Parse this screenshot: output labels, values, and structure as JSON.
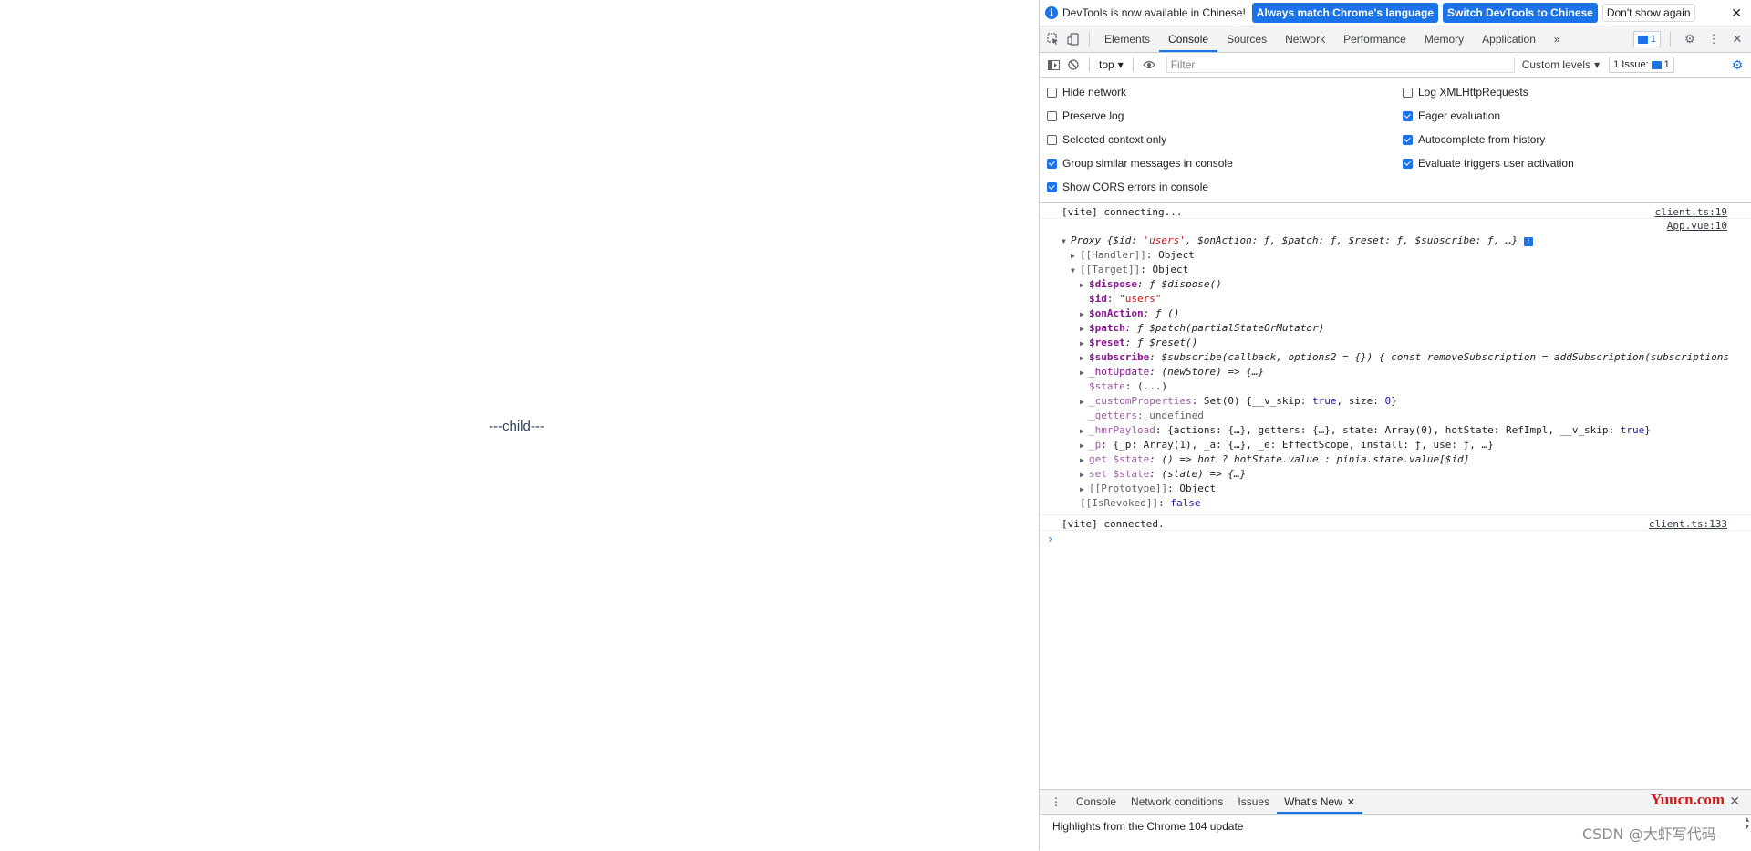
{
  "page": {
    "child_text": "---child---"
  },
  "infobar": {
    "message": "DevTools is now available in Chinese!",
    "btn_match": "Always match Chrome's language",
    "btn_switch": "Switch DevTools to Chinese",
    "btn_dont_show": "Don't show again",
    "info_icon": "info-icon",
    "close_glyph": "✕"
  },
  "tabs": {
    "items": [
      "Elements",
      "Console",
      "Sources",
      "Network",
      "Performance",
      "Memory",
      "Application"
    ],
    "active": "Console",
    "more_glyph": "»",
    "issues_count": "1"
  },
  "toolbar": {
    "context": "top",
    "filter_placeholder": "Filter",
    "levels": "Custom levels",
    "issue_btn": "1 Issue:",
    "issue_count": "1"
  },
  "settings": {
    "left": [
      {
        "label": "Hide network",
        "checked": false
      },
      {
        "label": "Preserve log",
        "checked": false
      },
      {
        "label": "Selected context only",
        "checked": false
      },
      {
        "label": "Group similar messages in console",
        "checked": true
      },
      {
        "label": "Show CORS errors in console",
        "checked": true
      }
    ],
    "right": [
      {
        "label": "Log XMLHttpRequests",
        "checked": false
      },
      {
        "label": "Eager evaluation",
        "checked": true
      },
      {
        "label": "Autocomplete from history",
        "checked": true
      },
      {
        "label": "Evaluate triggers user activation",
        "checked": true
      }
    ]
  },
  "console": {
    "log1": {
      "text": "[vite] connecting...",
      "source": "client.ts:19"
    },
    "proxy": {
      "source": "App.vue:10",
      "summary_prefix": "Proxy {$id: ",
      "summary_id": "'users'",
      "summary_rest": ", $onAction: ƒ, $patch: ƒ, $reset: ƒ, $subscribe: ƒ, …}",
      "handler": "[[Handler]]",
      "handler_val": ": Object",
      "target": "[[Target]]",
      "target_val": ": Object",
      "dispose_k": "$dispose",
      "dispose_v": ": ƒ $dispose()",
      "id_k": "$id",
      "id_v": "\"users\"",
      "onaction_k": "$onAction",
      "onaction_v": ": ƒ ()",
      "patch_k": "$patch",
      "patch_v": ": ƒ $patch(partialStateOrMutator)",
      "reset_k": "$reset",
      "reset_v": ": ƒ $reset()",
      "subscribe_k": "$subscribe",
      "subscribe_v": ": $subscribe(callback, options2 = {}) { const removeSubscription = addSubscription(subscriptions",
      "hotupdate_k": "_hotUpdate",
      "hotupdate_v": ": (newStore) => {…}",
      "state_k": "$state",
      "state_v": ": (...)",
      "customprops_k": "_customProperties",
      "customprops_v1": ": Set(0) {__v_skip: ",
      "customprops_true": "true",
      "customprops_v2": ", size: ",
      "customprops_zero": "0",
      "customprops_v3": "}",
      "getters_k": "_getters",
      "getters_v": ": undefined",
      "hmr_k": "_hmrPayload",
      "hmr_v1": ": {actions: {…}, getters: {…}, state: Array(0), hotState: RefImpl, __v_skip: ",
      "hmr_true": "true",
      "hmr_v2": "}",
      "p_k": "_p",
      "p_v": ": {_p: Array(1), _a: {…}, _e: EffectScope, install: ƒ, use: ƒ, …}",
      "getstate_k": "get $state",
      "getstate_v": ": () => hot ? hotState.value : pinia.state.value[$id]",
      "setstate_k": "set $state",
      "setstate_v": ": (state) => {…}",
      "proto_k": "[[Prototype]]",
      "proto_v": ": Object",
      "revoked_k": "[[IsRevoked]]",
      "revoked_v": "false"
    },
    "log2": {
      "text": "[vite] connected.",
      "source": "client.ts:133"
    },
    "prompt": "›"
  },
  "drawer": {
    "tabs": [
      "Console",
      "Network conditions",
      "Issues",
      "What's New"
    ],
    "active": "What's New",
    "body": "Highlights from the Chrome 104 update"
  },
  "watermarks": {
    "top": "Yuucn.com",
    "bottom": "CSDN @大虾写代码"
  },
  "colors": {
    "accent": "#1a73e8",
    "key": "#881391",
    "string": "#c41a16",
    "keyword": "#1a1aa6"
  }
}
